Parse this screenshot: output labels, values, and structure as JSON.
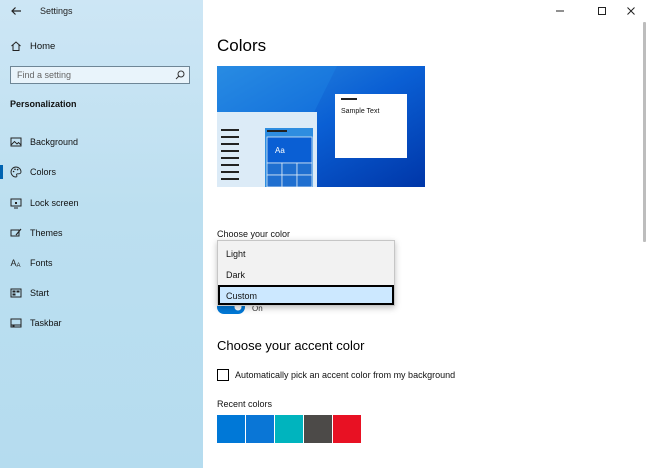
{
  "window": {
    "app_title": "Settings"
  },
  "sidebar": {
    "home_label": "Home",
    "search_placeholder": "Find a setting",
    "section_label": "Personalization",
    "items": [
      {
        "label": "Background",
        "icon": "picture-icon"
      },
      {
        "label": "Colors",
        "icon": "palette-icon"
      },
      {
        "label": "Lock screen",
        "icon": "lock-screen-icon"
      },
      {
        "label": "Themes",
        "icon": "themes-icon"
      },
      {
        "label": "Fonts",
        "icon": "fonts-icon"
      },
      {
        "label": "Start",
        "icon": "start-icon"
      },
      {
        "label": "Taskbar",
        "icon": "taskbar-icon"
      }
    ],
    "active_item": "Colors"
  },
  "main": {
    "title": "Colors",
    "preview": {
      "sample_text": "Sample Text",
      "tile_text": "Aa"
    },
    "choose_color_label": "Choose your color",
    "dropdown": {
      "options": [
        "Light",
        "Dark",
        "Custom"
      ],
      "selected": "Custom"
    },
    "toggle_text": "On",
    "accent_heading": "Choose your accent color",
    "auto_accent_label": "Automatically pick an accent color from my background",
    "auto_accent_checked": false,
    "recent_colors_label": "Recent colors",
    "recent_colors": [
      "#0078d7",
      "#0a76d6",
      "#00b4be",
      "#4c4a48",
      "#e81123"
    ]
  },
  "colors": {
    "accent": "#0078d7",
    "sidebar_bg": "#bcdff0"
  }
}
